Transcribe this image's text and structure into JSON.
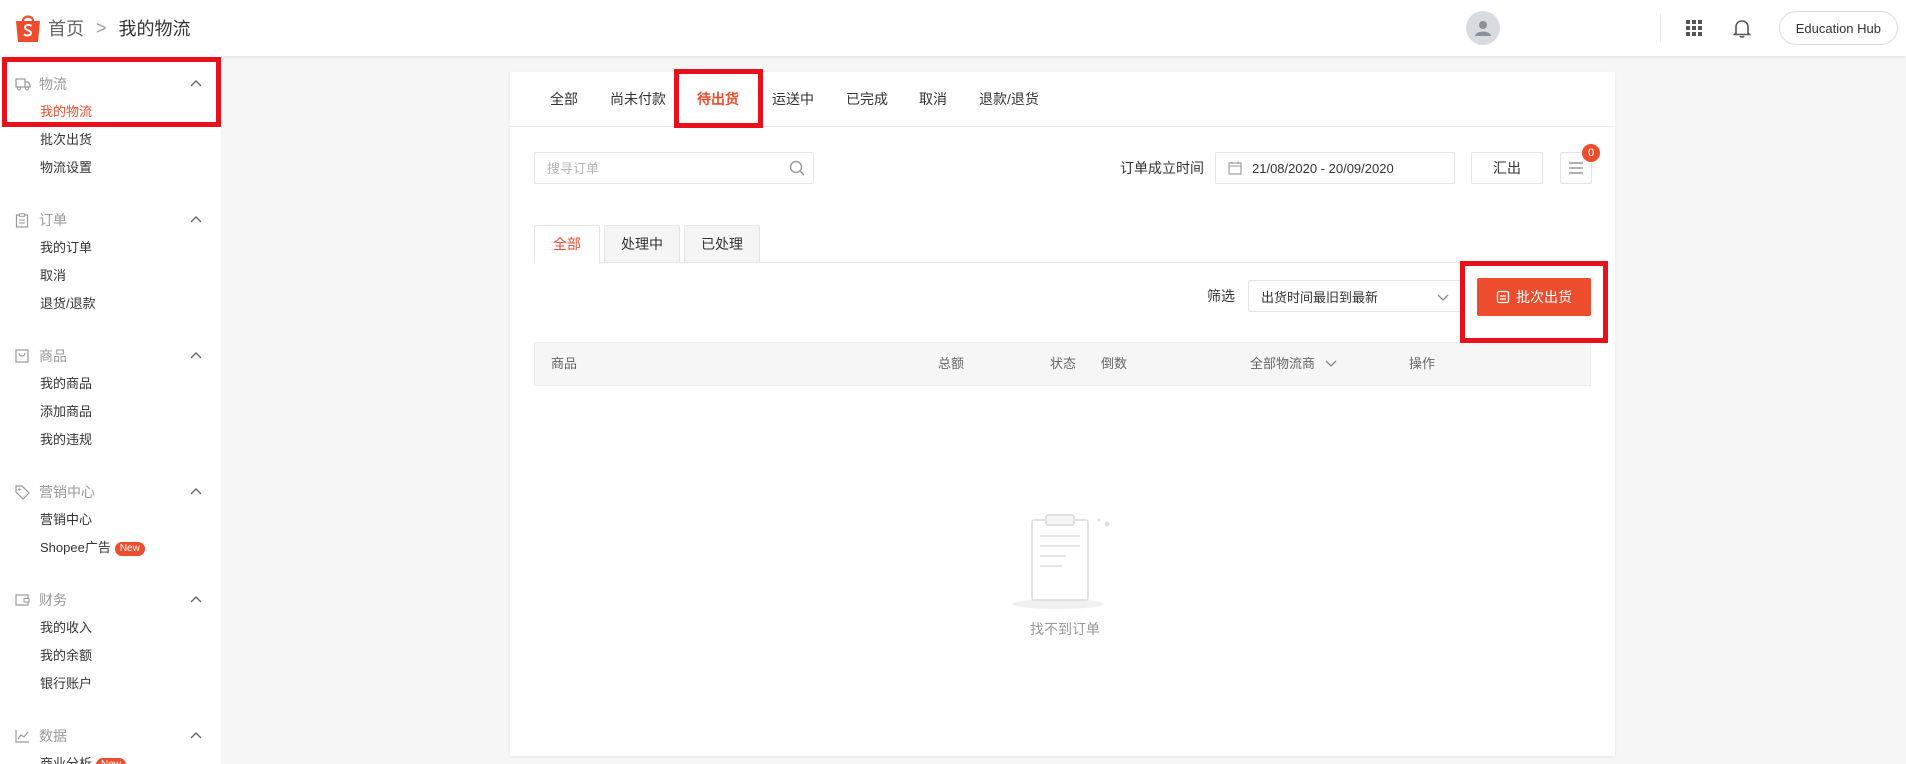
{
  "header": {
    "home_label": "首页",
    "separator": ">",
    "current_page": "我的物流",
    "education_hub": "Education Hub"
  },
  "sidebar": {
    "groups": [
      {
        "title": "物流",
        "icon": "truck-icon",
        "items": [
          "我的物流",
          "批次出货",
          "物流设置"
        ]
      },
      {
        "title": "订单",
        "icon": "clipboard-icon",
        "items": [
          "我的订单",
          "取消",
          "退货/退款"
        ]
      },
      {
        "title": "商品",
        "icon": "box-icon",
        "items": [
          "我的商品",
          "添加商品",
          "我的违规"
        ]
      },
      {
        "title": "营销中心",
        "icon": "tag-icon",
        "items": [
          "营销中心",
          "Shopee广告"
        ]
      },
      {
        "title": "财务",
        "icon": "wallet-icon",
        "items": [
          "我的收入",
          "我的余额",
          "银行账户"
        ]
      },
      {
        "title": "数据",
        "icon": "chart-icon",
        "items": [
          "商业分析"
        ]
      }
    ],
    "new_badge": "New"
  },
  "tabs": [
    "全部",
    "尚未付款",
    "待出货",
    "运送中",
    "已完成",
    "取消",
    "退款/退货"
  ],
  "toolbar": {
    "search_placeholder": "搜寻订单",
    "date_label": "订单成立时间",
    "date_range": "21/08/2020 - 20/09/2020",
    "export_label": "汇出",
    "list_badge_count": "0"
  },
  "subtabs": [
    "全部",
    "处理中",
    "已处理"
  ],
  "filter": {
    "label": "筛选",
    "selected": "出货时间最旧到最新"
  },
  "batch_ship_label": "批次出货",
  "table": {
    "headers": [
      "商品",
      "总额",
      "状态",
      "倒数",
      "全部物流商",
      "操作"
    ]
  },
  "empty_text": "找不到订单",
  "colors": {
    "brand": "#ee4d2d",
    "highlight": "#e8101a"
  }
}
